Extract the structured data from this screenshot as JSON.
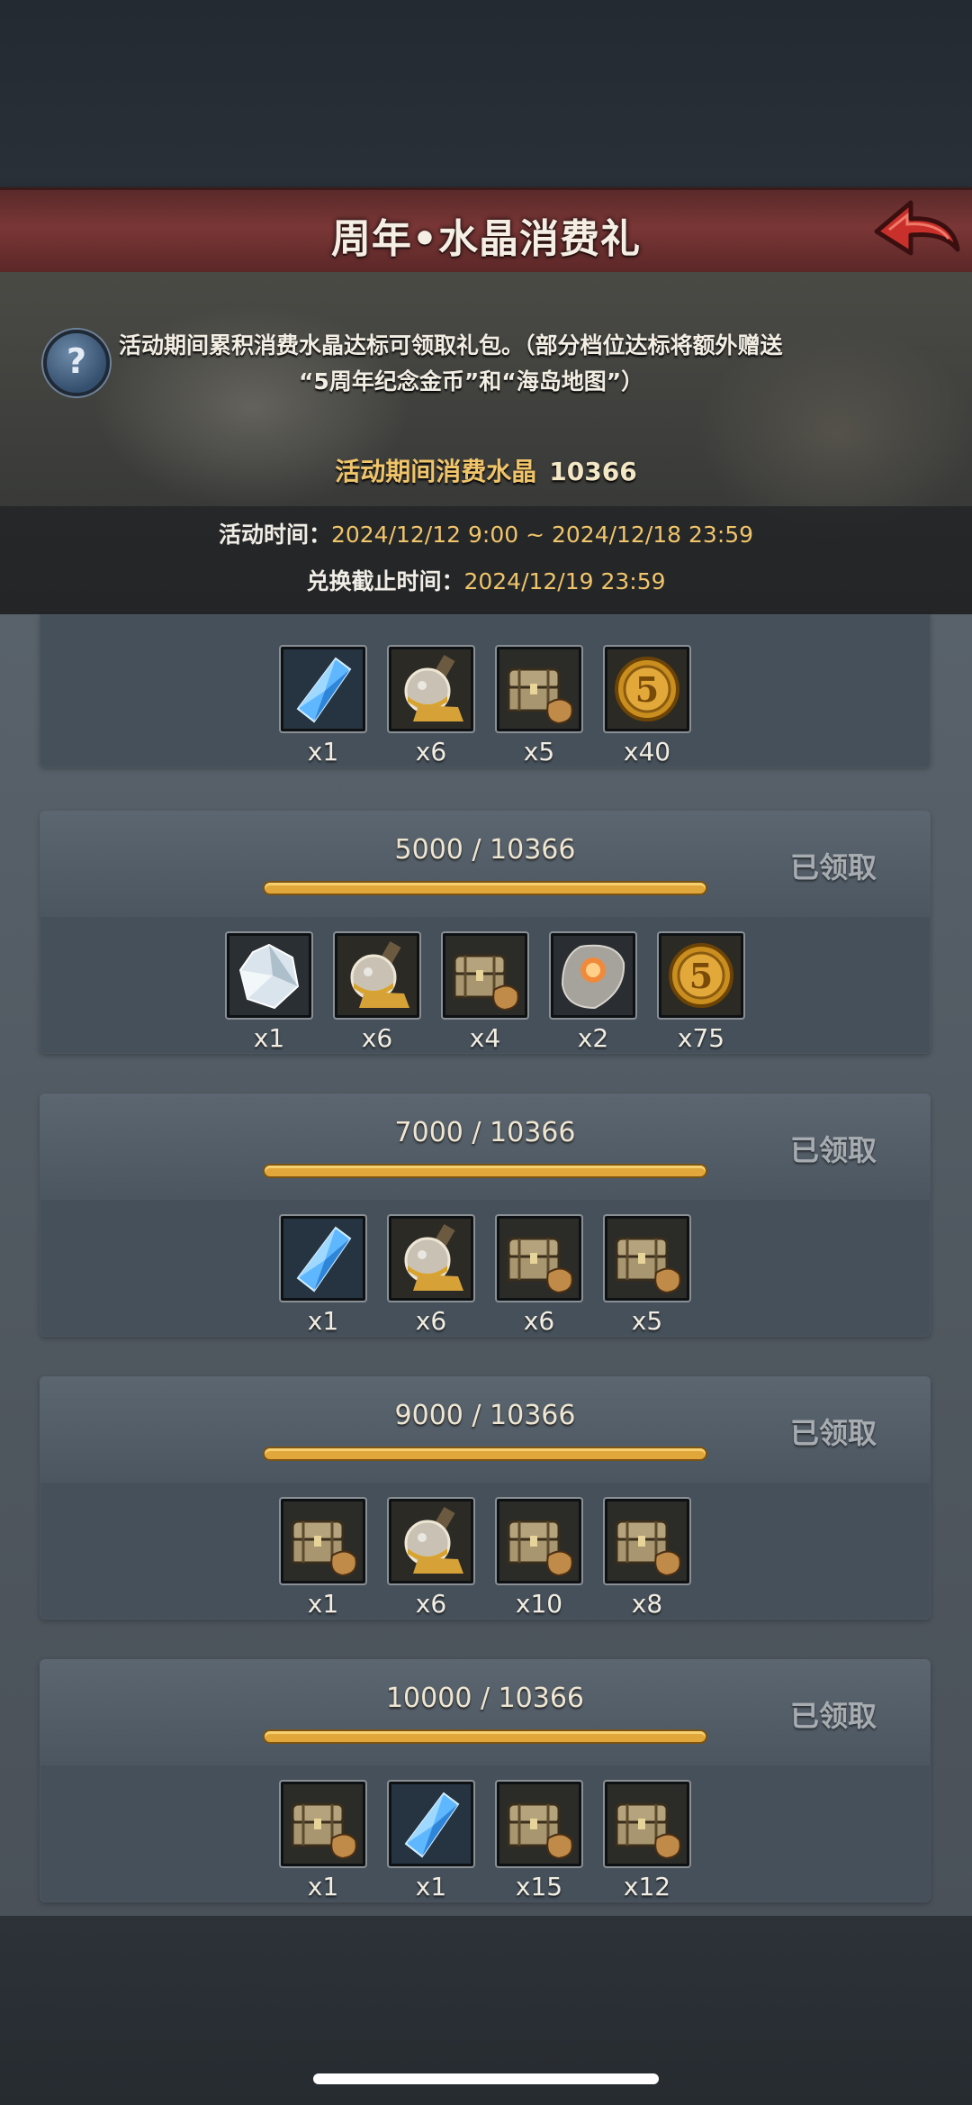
{
  "header": {
    "title": "周年•水晶消费礼"
  },
  "info": {
    "desc_line1": "活动期间累积消费水晶达标可领取礼包。（部分档位达标将额外赠送",
    "desc_line2": "“5周年纪念金币”和“海岛地图”）",
    "consume_label": "活动期间消费水晶",
    "consume_value": "10366",
    "event_time_label": "活动时间：",
    "event_time_value": "2024/12/12 9:00 ~ 2024/12/18 23:59",
    "exchange_label": "兑换截止时间：",
    "exchange_value": "2024/12/19 23:59"
  },
  "tiers": [
    {
      "items": [
        {
          "icon": "blue-crystal-icon",
          "qty": "x1"
        },
        {
          "icon": "gold-potion-icon",
          "qty": "x6"
        },
        {
          "icon": "treasure-chest-icon",
          "qty": "x5"
        },
        {
          "icon": "gold-coin-5-icon",
          "qty": "x40"
        }
      ]
    },
    {
      "progress": "5000 / 10366",
      "status": "已领取",
      "items": [
        {
          "icon": "white-crystal-icon",
          "qty": "x1"
        },
        {
          "icon": "gold-potion-icon",
          "qty": "x6"
        },
        {
          "icon": "treasure-chest-icon",
          "qty": "x4"
        },
        {
          "icon": "orange-gem-stone-icon",
          "qty": "x2"
        },
        {
          "icon": "gold-coin-5-icon",
          "qty": "x75"
        }
      ]
    },
    {
      "progress": "7000 / 10366",
      "status": "已领取",
      "items": [
        {
          "icon": "blue-crystal-icon",
          "qty": "x1"
        },
        {
          "icon": "gold-potion-icon",
          "qty": "x6"
        },
        {
          "icon": "treasure-chest-icon",
          "qty": "x6"
        },
        {
          "icon": "treasure-chest-icon",
          "qty": "x5"
        }
      ]
    },
    {
      "progress": "9000 / 10366",
      "status": "已领取",
      "items": [
        {
          "icon": "treasure-chest-icon",
          "qty": "x1"
        },
        {
          "icon": "gold-potion-icon",
          "qty": "x6"
        },
        {
          "icon": "treasure-chest-icon",
          "qty": "x10"
        },
        {
          "icon": "treasure-chest-icon",
          "qty": "x8"
        }
      ]
    },
    {
      "progress": "10000 / 10366",
      "status": "已领取",
      "items": [
        {
          "icon": "treasure-chest-icon",
          "qty": "x1"
        },
        {
          "icon": "blue-crystal-icon",
          "qty": "x1"
        },
        {
          "icon": "treasure-chest-icon",
          "qty": "x15"
        },
        {
          "icon": "treasure-chest-icon",
          "qty": "x12"
        }
      ]
    }
  ],
  "colors": {
    "accent_gold": "#f0c46a",
    "title_bar": "#7a3636",
    "progress_fill": "#e2a73a"
  }
}
